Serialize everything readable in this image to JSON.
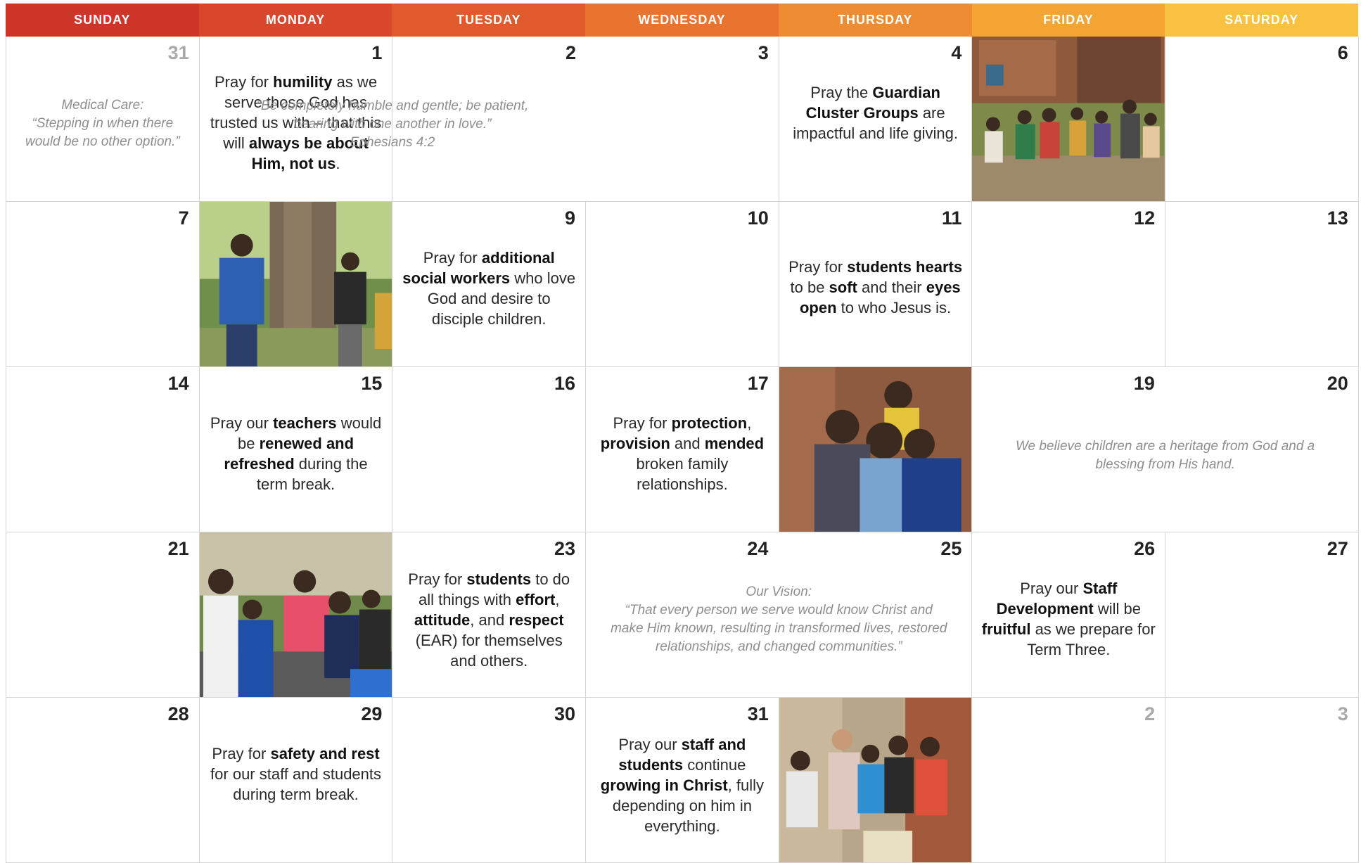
{
  "header": {
    "days": [
      "SUNDAY",
      "MONDAY",
      "TUESDAY",
      "WEDNESDAY",
      "THURSDAY",
      "FRIDAY",
      "SATURDAY"
    ],
    "colors": [
      "#cf3428",
      "#d8462c",
      "#e05a2c",
      "#e9742f",
      "#ee8c33",
      "#f4a432",
      "#f8c141"
    ]
  },
  "cells": {
    "c31a": {
      "num": "31"
    },
    "c31a_quote": {
      "l1": "Medical Care:",
      "l2": "“Stepping in when there",
      "l3": "would be no other option.”"
    },
    "c1": {
      "num": "1"
    },
    "c1_text": {
      "a": "Pray for ",
      "b": "humility",
      "c": " as we serve those God has trusted us with – that this will ",
      "d": "always be about Him, not us",
      "e": "."
    },
    "c2": {
      "num": "2"
    },
    "c3": {
      "num": "3"
    },
    "c23_quote": {
      "l1": "“Be completely humble and gentle; be patient,",
      "l2": "bearing with one another in love.”",
      "l3": "Ephesians 4:2"
    },
    "c4": {
      "num": "4"
    },
    "c4_text": {
      "a": "Pray the ",
      "b": "Guardian Cluster Groups",
      "c": " are impactful and life giving."
    },
    "c6": {
      "num": "6"
    },
    "c7": {
      "num": "7"
    },
    "c9": {
      "num": "9"
    },
    "c9_text": {
      "a": "Pray for ",
      "b": "additional social workers",
      "c": " who love God and desire to disciple children."
    },
    "c10": {
      "num": "10"
    },
    "c11": {
      "num": "11"
    },
    "c11_text": {
      "a": "Pray for ",
      "b": "students hearts",
      "c": " to be ",
      "d": "soft",
      "e": " and their ",
      "f": "eyes open",
      "g": " to who Jesus is."
    },
    "c12": {
      "num": "12"
    },
    "c13": {
      "num": "13"
    },
    "c14": {
      "num": "14"
    },
    "c15": {
      "num": "15"
    },
    "c15_text": {
      "a": "Pray our ",
      "b": "teachers",
      "c": " would be ",
      "d": "renewed and refreshed",
      "e": " during the term break."
    },
    "c16": {
      "num": "16"
    },
    "c17": {
      "num": "17"
    },
    "c17_text": {
      "a": "Pray for ",
      "b": "protection",
      "c": ", ",
      "d": "provision",
      "e": " and ",
      "f": "mended",
      "g": " broken family relationships."
    },
    "c19": {
      "num": "19"
    },
    "c20": {
      "num": "20"
    },
    "c1920_quote": {
      "l1": "We believe children are a heritage from God and a",
      "l2": "blessing from His hand."
    },
    "c21": {
      "num": "21"
    },
    "c23": {
      "num": "23"
    },
    "c23_text": {
      "a": "Pray for ",
      "b": "students",
      "c": " to do all things with ",
      "d": "effort",
      "e": ", ",
      "f": "attitude",
      "g": ", and ",
      "h": "respect",
      "i": " (EAR) for themselves and others."
    },
    "c24": {
      "num": "24"
    },
    "c25": {
      "num": "25"
    },
    "c2425_quote": {
      "l1": "Our Vision:",
      "l2": "“That every person we serve would know Christ and",
      "l3": "make Him known, resulting in transformed lives, restored",
      "l4": "relationships, and changed communities.”"
    },
    "c26": {
      "num": "26"
    },
    "c26_text": {
      "a": "Pray our ",
      "b": "Staff Development",
      "c": " will be ",
      "d": "fruitful",
      "e": " as we prepare for Term Three."
    },
    "c27": {
      "num": "27"
    },
    "c28": {
      "num": "28"
    },
    "c29": {
      "num": "29"
    },
    "c29_text": {
      "a": "Pray for ",
      "b": "safety and rest",
      "c": " for our staff and students during term break."
    },
    "c30": {
      "num": "30"
    },
    "c31b": {
      "num": "31"
    },
    "c31b_text": {
      "a": "Pray our ",
      "b": "staff and students",
      "c": " continue ",
      "d": "growing in Christ",
      "e": ", fully depending on him in everything."
    },
    "n2": {
      "num": "2"
    },
    "n3": {
      "num": "3"
    }
  }
}
